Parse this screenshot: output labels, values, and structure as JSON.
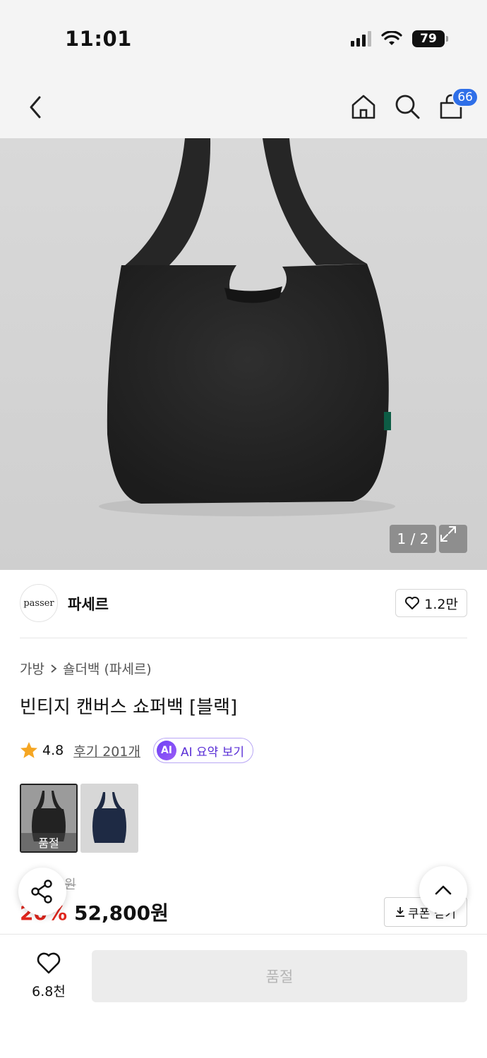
{
  "status_bar": {
    "time": "11:01",
    "battery": "79",
    "icons": [
      "signal-icon",
      "wifi-icon",
      "battery-icon"
    ]
  },
  "header": {
    "icons": [
      "back-chevron-icon",
      "home-icon",
      "search-icon",
      "cart-icon"
    ],
    "cart_count": "66"
  },
  "gallery": {
    "counter": "1 / 2",
    "icons": [
      "expand-icon"
    ]
  },
  "brand": {
    "logo_text": "passer",
    "name": "파세르",
    "like_count": "1.2만"
  },
  "product": {
    "breadcrumb": [
      "가방",
      "숄더백 (파세르)"
    ],
    "title": "빈티지 캔버스 쇼퍼백 [블랙]",
    "rating": "4.8",
    "reviews": "후기 201개",
    "ai_badge": "AI",
    "ai_summary": "AI 요약 보기",
    "options": [
      {
        "color": "black",
        "label": "품절"
      },
      {
        "color": "navy",
        "label": ""
      }
    ],
    "original_price": "66,000원",
    "discount": "20%",
    "price": "52,800원",
    "coupon_label": "쿠폰 받기"
  },
  "floating": {
    "icons": [
      "share-icon",
      "scroll-top-icon"
    ]
  },
  "bottom_bar": {
    "wish_count": "6.8천",
    "buy_label": "품절"
  },
  "colors": {
    "accent_blue": "#2f6fe8",
    "discount_red": "#e0261d",
    "ai_purple": "#6d42f5",
    "star": "#f5a623"
  }
}
